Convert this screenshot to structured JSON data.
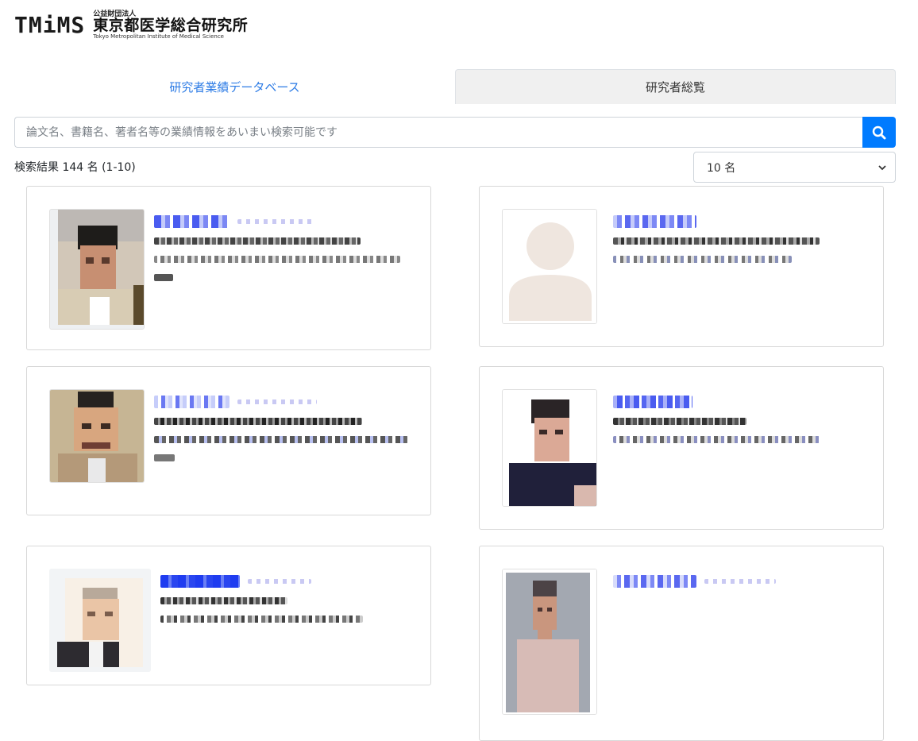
{
  "header": {
    "logo_mark": "TMiMS",
    "logo_small": "公益財団法人",
    "logo_main": "東京都医学総合研究所",
    "logo_en": "Tokyo Metropolitan Institute of Medical Science"
  },
  "tabs": [
    {
      "label": "研究者業績データベース",
      "active": false
    },
    {
      "label": "研究者総覧",
      "active": true
    }
  ],
  "search": {
    "placeholder": "論文名、書籍名、著者名等の業績情報をあいまい検索可能です",
    "button_icon": "search-icon"
  },
  "results": {
    "count_text": "検索結果 144 名 (1-10)"
  },
  "per_page": {
    "selected": "10 名",
    "icon": "chevron-down-icon"
  },
  "colors": {
    "accent": "#007bff",
    "link": "#2c7be5",
    "tab_inactive_bg": "#f0f0f0"
  },
  "researchers": [
    {
      "photo": "photo-man-1",
      "default_avatar": false
    },
    {
      "photo": "default-avatar",
      "default_avatar": true
    },
    {
      "photo": "photo-man-2",
      "default_avatar": false
    },
    {
      "photo": "photo-man-3",
      "default_avatar": false
    },
    {
      "photo": "photo-man-4",
      "default_avatar": false
    },
    {
      "photo": "photo-woman-1",
      "default_avatar": false
    }
  ]
}
